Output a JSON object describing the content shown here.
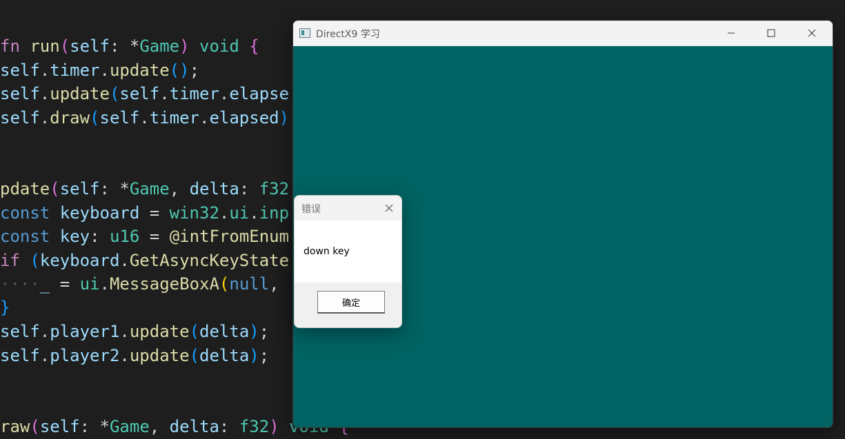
{
  "editor": {
    "lines": [
      [
        {
          "t": "fn",
          "c": "kw"
        },
        {
          "t": " ",
          "c": "op"
        },
        {
          "t": "run",
          "c": "fn"
        },
        {
          "t": "(",
          "c": "br1"
        },
        {
          "t": "self",
          "c": "id"
        },
        {
          "t": ": *",
          "c": "op"
        },
        {
          "t": "Game",
          "c": "ty"
        },
        {
          "t": ")",
          "c": "br1"
        },
        {
          "t": " ",
          "c": "op"
        },
        {
          "t": "void",
          "c": "ty"
        },
        {
          "t": " ",
          "c": "op"
        },
        {
          "t": "{",
          "c": "br1"
        }
      ],
      [
        {
          "t": "self",
          "c": "id"
        },
        {
          "t": ".",
          "c": "op"
        },
        {
          "t": "timer",
          "c": "id"
        },
        {
          "t": ".",
          "c": "op"
        },
        {
          "t": "update",
          "c": "fn"
        },
        {
          "t": "()",
          "c": "br2"
        },
        {
          "t": ";",
          "c": "op"
        }
      ],
      [
        {
          "t": "self",
          "c": "id"
        },
        {
          "t": ".",
          "c": "op"
        },
        {
          "t": "update",
          "c": "fn"
        },
        {
          "t": "(",
          "c": "br2"
        },
        {
          "t": "self",
          "c": "id"
        },
        {
          "t": ".",
          "c": "op"
        },
        {
          "t": "timer",
          "c": "id"
        },
        {
          "t": ".",
          "c": "op"
        },
        {
          "t": "elapse",
          "c": "id"
        }
      ],
      [
        {
          "t": "self",
          "c": "id"
        },
        {
          "t": ".",
          "c": "op"
        },
        {
          "t": "draw",
          "c": "fn"
        },
        {
          "t": "(",
          "c": "br2"
        },
        {
          "t": "self",
          "c": "id"
        },
        {
          "t": ".",
          "c": "op"
        },
        {
          "t": "timer",
          "c": "id"
        },
        {
          "t": ".",
          "c": "op"
        },
        {
          "t": "elapsed",
          "c": "id"
        },
        {
          "t": ")",
          "c": "br2"
        }
      ],
      [],
      [],
      [
        {
          "t": "pdate",
          "c": "fn"
        },
        {
          "t": "(",
          "c": "br1"
        },
        {
          "t": "self",
          "c": "id"
        },
        {
          "t": ": *",
          "c": "op"
        },
        {
          "t": "Game",
          "c": "ty"
        },
        {
          "t": ", ",
          "c": "op"
        },
        {
          "t": "delta",
          "c": "id"
        },
        {
          "t": ": ",
          "c": "op"
        },
        {
          "t": "f32",
          "c": "ty"
        }
      ],
      [
        {
          "t": "const",
          "c": "kw2"
        },
        {
          "t": " ",
          "c": "op"
        },
        {
          "t": "keyboard",
          "c": "id"
        },
        {
          "t": " = ",
          "c": "op"
        },
        {
          "t": "win32",
          "c": "green"
        },
        {
          "t": ".",
          "c": "op"
        },
        {
          "t": "ui",
          "c": "green"
        },
        {
          "t": ".",
          "c": "op"
        },
        {
          "t": "inp",
          "c": "green"
        }
      ],
      [
        {
          "t": "const",
          "c": "kw2"
        },
        {
          "t": " ",
          "c": "op"
        },
        {
          "t": "key",
          "c": "id"
        },
        {
          "t": ": ",
          "c": "op"
        },
        {
          "t": "u16",
          "c": "ty"
        },
        {
          "t": " = ",
          "c": "op"
        },
        {
          "t": "@intFromEnum",
          "c": "fn"
        }
      ],
      [
        {
          "t": "if",
          "c": "kw"
        },
        {
          "t": " ",
          "c": "op"
        },
        {
          "t": "(",
          "c": "br2"
        },
        {
          "t": "keyboard",
          "c": "id"
        },
        {
          "t": ".",
          "c": "op"
        },
        {
          "t": "GetAsyncKeyState",
          "c": "fn"
        }
      ],
      [
        {
          "t": "····",
          "c": "ws"
        },
        {
          "t": "_",
          "c": "id"
        },
        {
          "t": " = ",
          "c": "op"
        },
        {
          "t": "ui",
          "c": "green"
        },
        {
          "t": ".",
          "c": "op"
        },
        {
          "t": "MessageBoxA",
          "c": "fn"
        },
        {
          "t": "(",
          "c": "br3"
        },
        {
          "t": "null",
          "c": "kw2"
        },
        {
          "t": ",",
          "c": "op"
        }
      ],
      [
        {
          "t": "}",
          "c": "br2"
        }
      ],
      [
        {
          "t": "self",
          "c": "id"
        },
        {
          "t": ".",
          "c": "op"
        },
        {
          "t": "player1",
          "c": "id"
        },
        {
          "t": ".",
          "c": "op"
        },
        {
          "t": "update",
          "c": "fn"
        },
        {
          "t": "(",
          "c": "br2"
        },
        {
          "t": "delta",
          "c": "id"
        },
        {
          "t": ")",
          "c": "br2"
        },
        {
          "t": ";",
          "c": "op"
        }
      ],
      [
        {
          "t": "self",
          "c": "id"
        },
        {
          "t": ".",
          "c": "op"
        },
        {
          "t": "player2",
          "c": "id"
        },
        {
          "t": ".",
          "c": "op"
        },
        {
          "t": "update",
          "c": "fn"
        },
        {
          "t": "(",
          "c": "br2"
        },
        {
          "t": "delta",
          "c": "id"
        },
        {
          "t": ")",
          "c": "br2"
        },
        {
          "t": ";",
          "c": "op"
        }
      ],
      [],
      [],
      [
        {
          "t": "raw",
          "c": "fn"
        },
        {
          "t": "(",
          "c": "br1"
        },
        {
          "t": "self",
          "c": "id"
        },
        {
          "t": ": *",
          "c": "op"
        },
        {
          "t": "Game",
          "c": "ty"
        },
        {
          "t": ", ",
          "c": "op"
        },
        {
          "t": "delta",
          "c": "id"
        },
        {
          "t": ": ",
          "c": "op"
        },
        {
          "t": "f32",
          "c": "ty"
        },
        {
          "t": ")",
          "c": "br1"
        },
        {
          "t": " ",
          "c": "op"
        },
        {
          "t": "void",
          "c": "ty"
        },
        {
          "t": " ",
          "c": "op"
        },
        {
          "t": "{",
          "c": "br1"
        }
      ]
    ]
  },
  "dx_window": {
    "title": "DirectX9 学习",
    "minimize_icon": "minimize-icon",
    "maximize_icon": "maximize-icon",
    "close_icon": "close-icon",
    "background_color": "#006262"
  },
  "message_box": {
    "title": "错误",
    "message": "down key",
    "ok_label": "确定",
    "close_icon": "close-icon"
  }
}
